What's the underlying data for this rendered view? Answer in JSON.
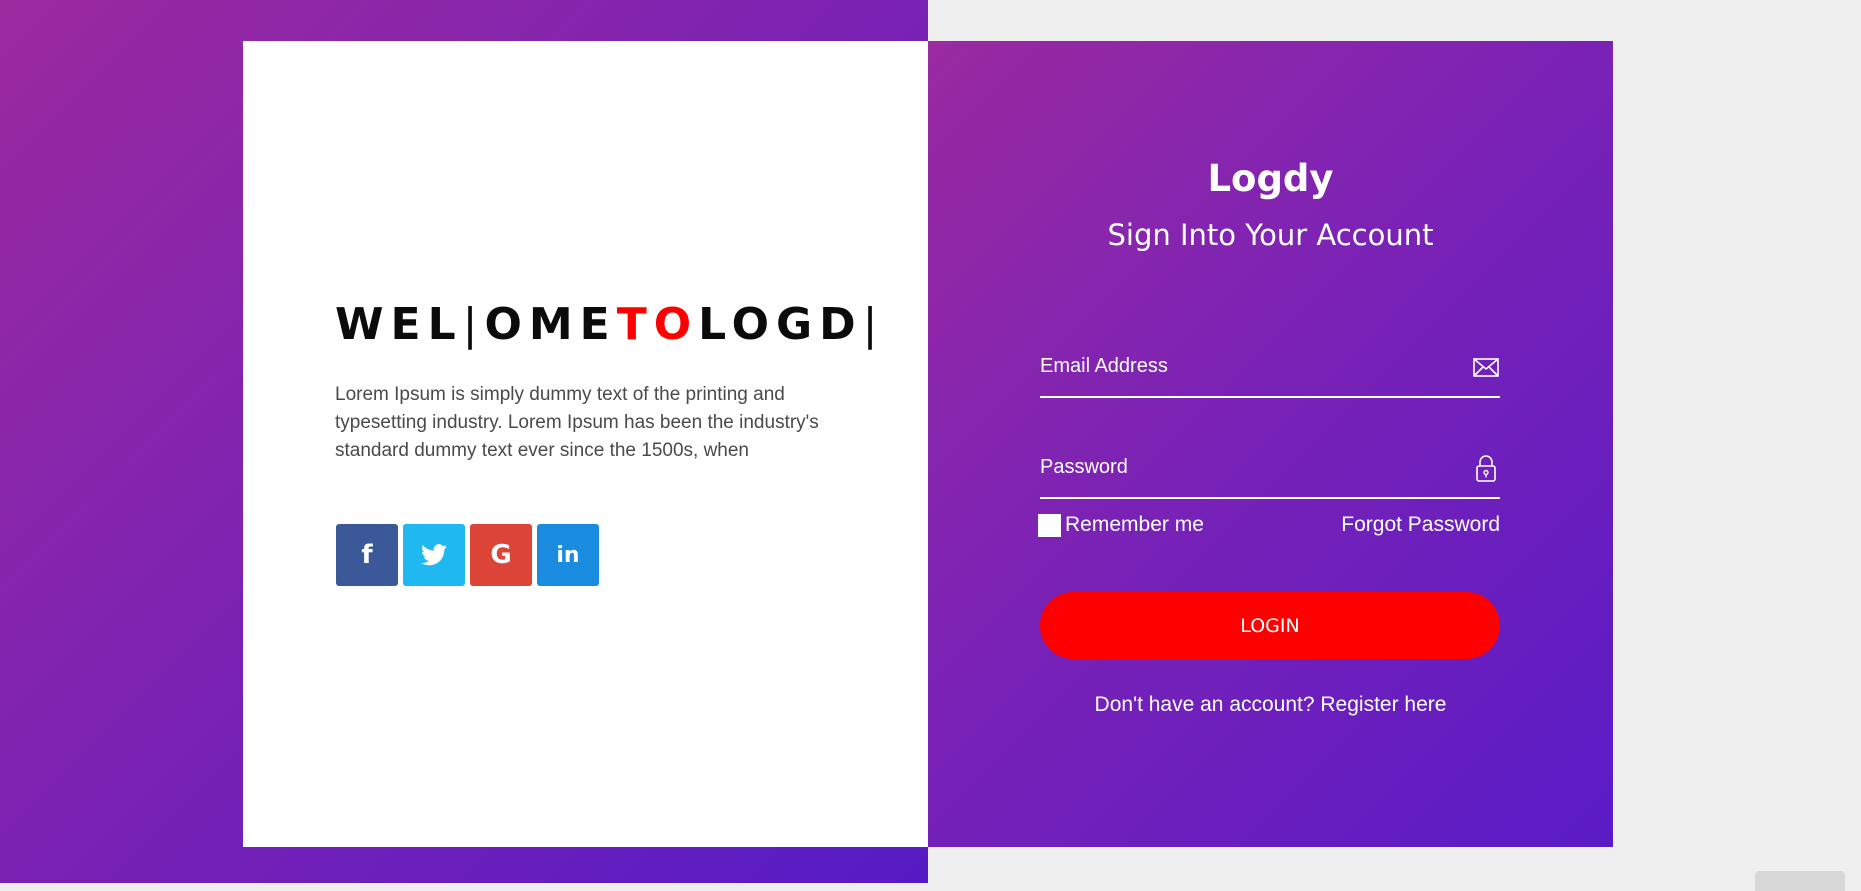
{
  "colors": {
    "accent_red": "#ff0000",
    "gradient_start": "#9b2a9f",
    "gradient_end": "#561bc6",
    "facebook": "#3b5998",
    "twitter": "#1fb8f0",
    "google": "#db4437",
    "linkedin": "#1a8ce0"
  },
  "welcome": {
    "heading_part1": "WEL",
    "heading_cursor1": "|",
    "heading_part2": "OME",
    "heading_accent": "TO",
    "heading_part3": "LOGD",
    "heading_cursor2": "|",
    "description": "Lorem Ipsum is simply dummy text of the printing and typesetting industry. Lorem Ipsum has been the industry's standard dummy text ever since the 1500s, when"
  },
  "social": [
    {
      "name": "facebook",
      "glyph": "f",
      "icon": "facebook-icon"
    },
    {
      "name": "twitter",
      "glyph": "🐦",
      "icon": "twitter-icon"
    },
    {
      "name": "google",
      "glyph": "G",
      "icon": "google-icon"
    },
    {
      "name": "linkedin",
      "glyph": "in",
      "icon": "linkedin-icon"
    }
  ],
  "login": {
    "brand": "Logdy",
    "subtitle": "Sign Into Your Account",
    "email_placeholder": "Email Address",
    "password_placeholder": "Password",
    "email_icon": "envelope-icon",
    "password_icon": "lock-icon",
    "remember_label": "Remember me",
    "forgot_label": "Forgot Password",
    "login_button": "LOGIN",
    "register_text": "Don't have an account? Register here"
  }
}
